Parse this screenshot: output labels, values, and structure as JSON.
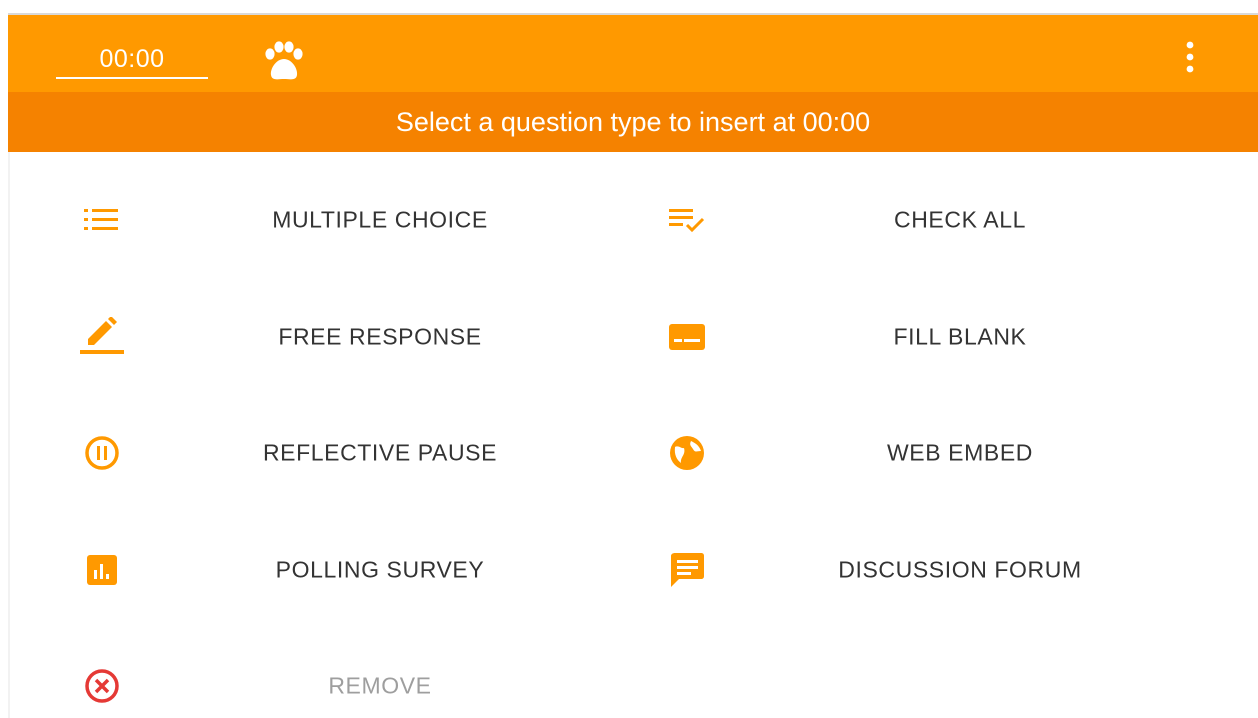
{
  "toolbar": {
    "time_value": "00:00",
    "logo_icon": "paw-icon",
    "menu_icon": "more-vert-icon"
  },
  "banner": {
    "text": "Select a question type to insert at 00:00"
  },
  "question_types": [
    {
      "label": "MULTIPLE CHOICE",
      "icon": "list-icon"
    },
    {
      "label": "CHECK ALL",
      "icon": "playlist-check-icon"
    },
    {
      "label": "FREE RESPONSE",
      "icon": "pencil-icon"
    },
    {
      "label": "FILL BLANK",
      "icon": "subtitles-icon"
    },
    {
      "label": "REFLECTIVE PAUSE",
      "icon": "pause-circle-icon"
    },
    {
      "label": "WEB EMBED",
      "icon": "globe-icon"
    },
    {
      "label": "POLLING SURVEY",
      "icon": "bar-chart-icon"
    },
    {
      "label": "DISCUSSION FORUM",
      "icon": "chat-icon"
    },
    {
      "label": "REMOVE",
      "icon": "remove-circle-icon"
    }
  ],
  "colors": {
    "toolbar": "#ff9900",
    "banner": "#f58200",
    "icon": "#ff9900",
    "remove_icon": "#e53935"
  }
}
